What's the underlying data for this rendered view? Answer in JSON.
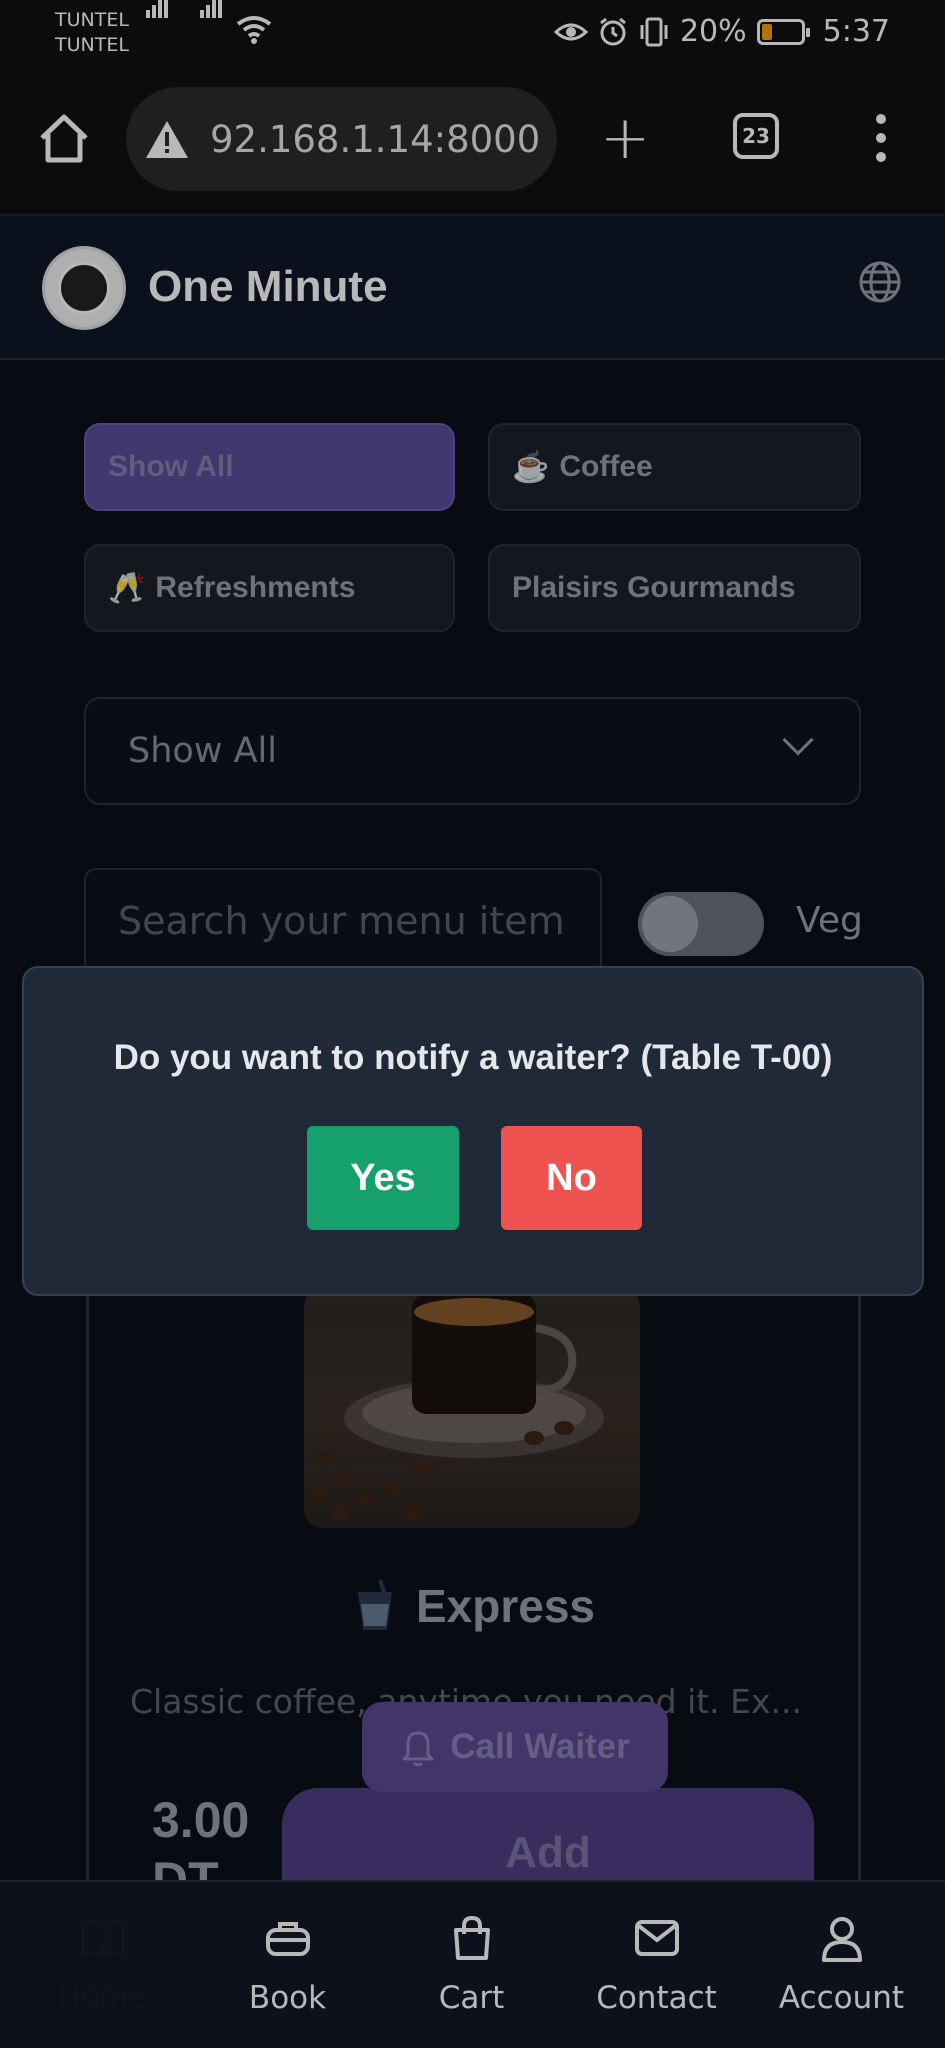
{
  "status_bar": {
    "carrier_1": "TUNTEL",
    "carrier_2": "TUNTEL",
    "battery": "20%",
    "time": "5:37"
  },
  "browser": {
    "url": "92.168.1.14:8000",
    "tab_count": "23"
  },
  "header": {
    "title": "One Minute"
  },
  "categories": [
    {
      "label": "Show All",
      "icon": "",
      "active": true
    },
    {
      "label": "Coffee",
      "icon": "☕",
      "active": false
    },
    {
      "label": "Refreshments",
      "icon": "🥂",
      "active": false
    },
    {
      "label": "Plaisirs Gourmands",
      "icon": "",
      "active": false
    }
  ],
  "filter_select": {
    "value": "Show All"
  },
  "search": {
    "placeholder": "Search your menu item"
  },
  "veg_toggle": {
    "label": "Veg",
    "on": false
  },
  "dialog": {
    "message": "Do you want to notify a waiter? (Table T-00)",
    "yes_label": "Yes",
    "no_label": "No"
  },
  "product": {
    "name": "Express",
    "description": "Classic coffee, anytime you need it. Ex...",
    "price": "3.00",
    "price_currency_partial": "DT",
    "add_label": "Add"
  },
  "call_waiter": {
    "label": "Call Waiter"
  },
  "bottom_nav": [
    {
      "label": "Home",
      "icon": "book-open-icon",
      "active": true
    },
    {
      "label": "Book",
      "icon": "briefcase-icon",
      "active": false
    },
    {
      "label": "Cart",
      "icon": "shopping-bag-icon",
      "active": false
    },
    {
      "label": "Contact",
      "icon": "mail-icon",
      "active": false
    },
    {
      "label": "Account",
      "icon": "user-icon",
      "active": false
    }
  ],
  "colors": {
    "accent": "#5b4b98",
    "yes": "#16a06b",
    "no": "#ef5350"
  }
}
